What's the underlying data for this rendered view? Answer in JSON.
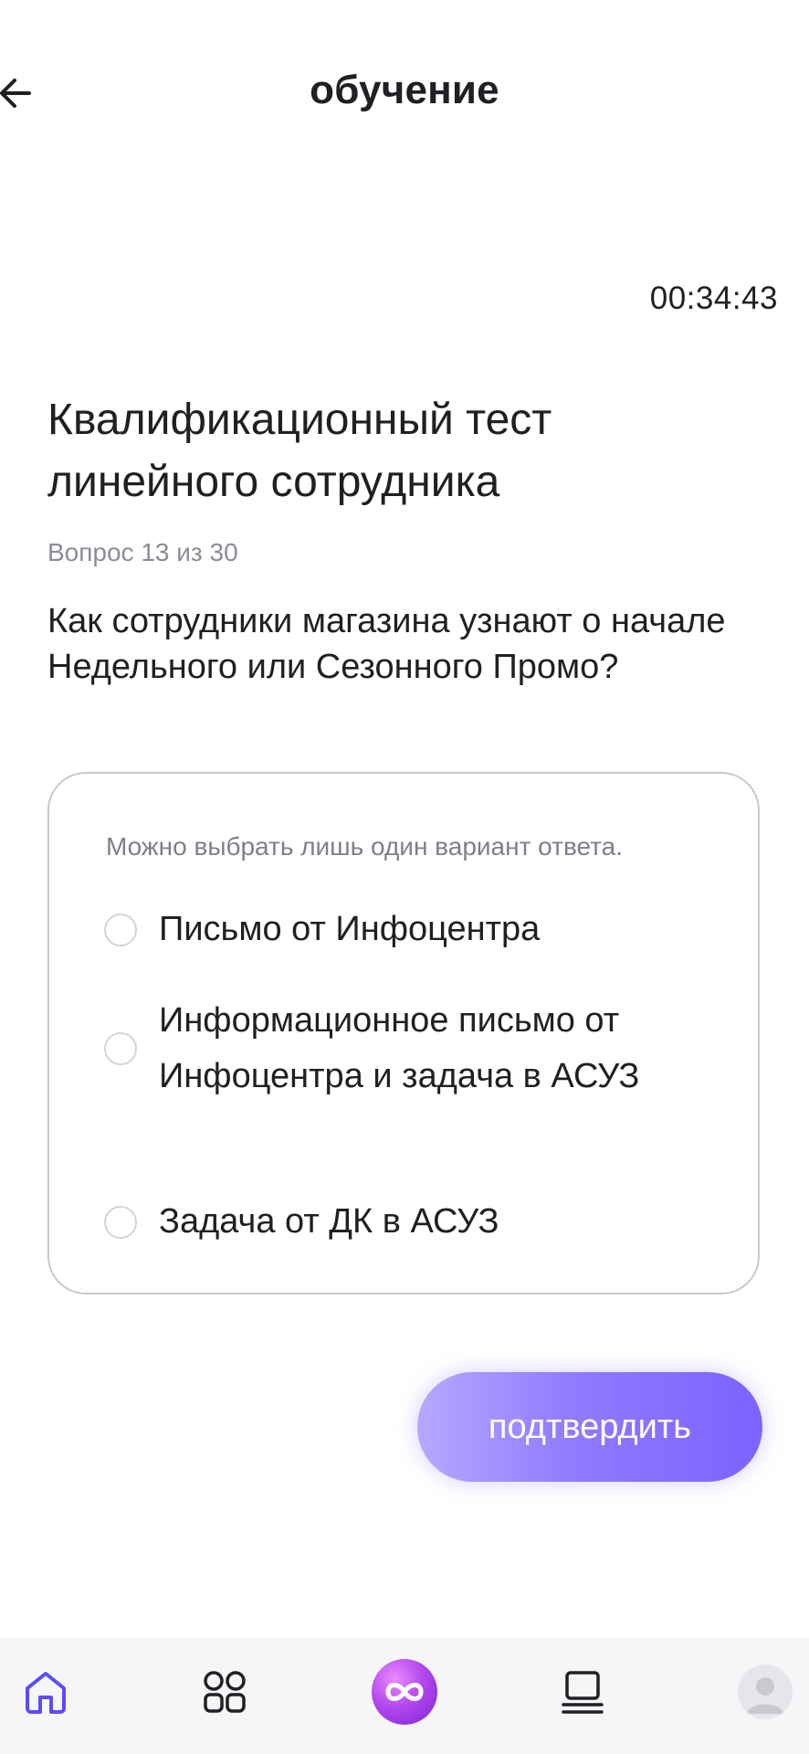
{
  "header": {
    "title": "обучение",
    "back_icon": "arrow-left-icon"
  },
  "timer": "00:34:43",
  "test": {
    "title": "Квалификационный тест линейного сотрудника",
    "counter": "Вопрос 13 из 30",
    "question": "Как сотрудники магазина узнают о начале Недельного или Сезонного Промо?"
  },
  "answers": {
    "hint": "Можно выбрать лишь один вариант ответа.",
    "options": [
      {
        "label": "Письмо от Инфоцентра",
        "selected": false
      },
      {
        "label": "Информационное письмо от Инфоцентра и задача в АСУЗ",
        "selected": false
      },
      {
        "label": "Задача от ДК в АСУЗ",
        "selected": false
      }
    ]
  },
  "confirm_button": {
    "label": "подтвердить"
  },
  "bottom_nav": {
    "items": [
      {
        "icon": "home-icon",
        "active": true
      },
      {
        "icon": "grid-icon",
        "active": false
      },
      {
        "icon": "infinity-icon",
        "active": false
      },
      {
        "icon": "laptop-icon",
        "active": false
      },
      {
        "icon": "avatar-icon",
        "active": false
      }
    ]
  },
  "colors": {
    "accent": "#7a63ff",
    "text": "#1f1f24",
    "muted": "#8a8d96",
    "nav_active": "#5b4bff"
  }
}
